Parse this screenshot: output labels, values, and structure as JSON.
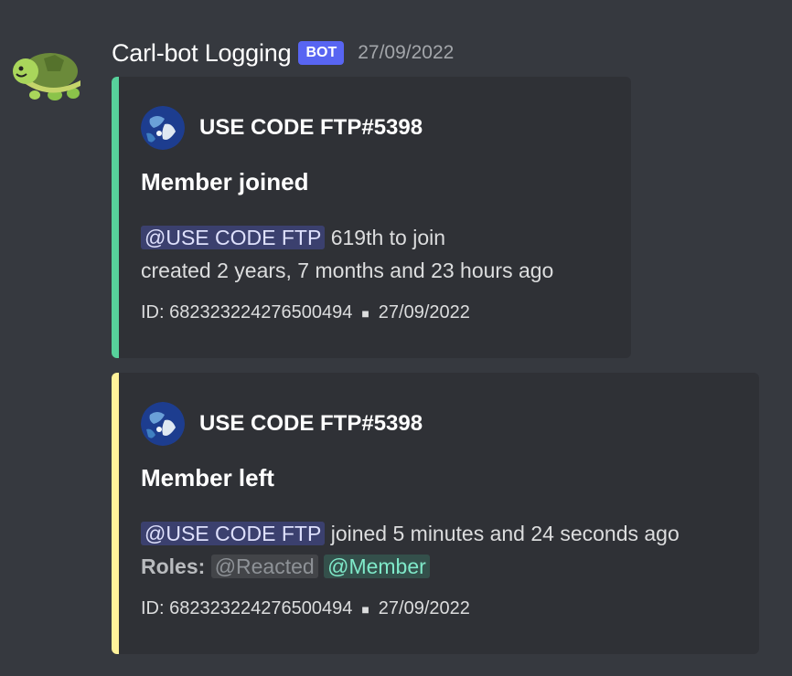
{
  "message": {
    "username": "Carl-bot Logging",
    "bot_tag": "BOT",
    "timestamp": "27/09/2022",
    "avatar_icon": "turtle-icon"
  },
  "embeds": [
    {
      "accent_color": "#57d19b",
      "author": "USE CODE FTP#5398",
      "title": "Member joined",
      "mention": "@USE CODE FTP",
      "line1_suffix": " 619th to join",
      "line2": "created 2 years, 7 months and 23 hours ago",
      "footer_id": "ID: 682323224276500494",
      "footer_date": "27/09/2022"
    },
    {
      "accent_color": "#fff29a",
      "author": "USE CODE FTP#5398",
      "title": "Member left",
      "mention": "@USE CODE FTP",
      "line1_suffix": " joined 5 minutes and 24 seconds ago",
      "roles_label": "Roles:",
      "roles": [
        "@Reacted",
        "@Member"
      ],
      "footer_id": "ID: 682323224276500494",
      "footer_date": "27/09/2022"
    }
  ],
  "colors": {
    "background": "#36393f",
    "embed_background": "#2f3136",
    "bot_tag": "#5865f2"
  }
}
